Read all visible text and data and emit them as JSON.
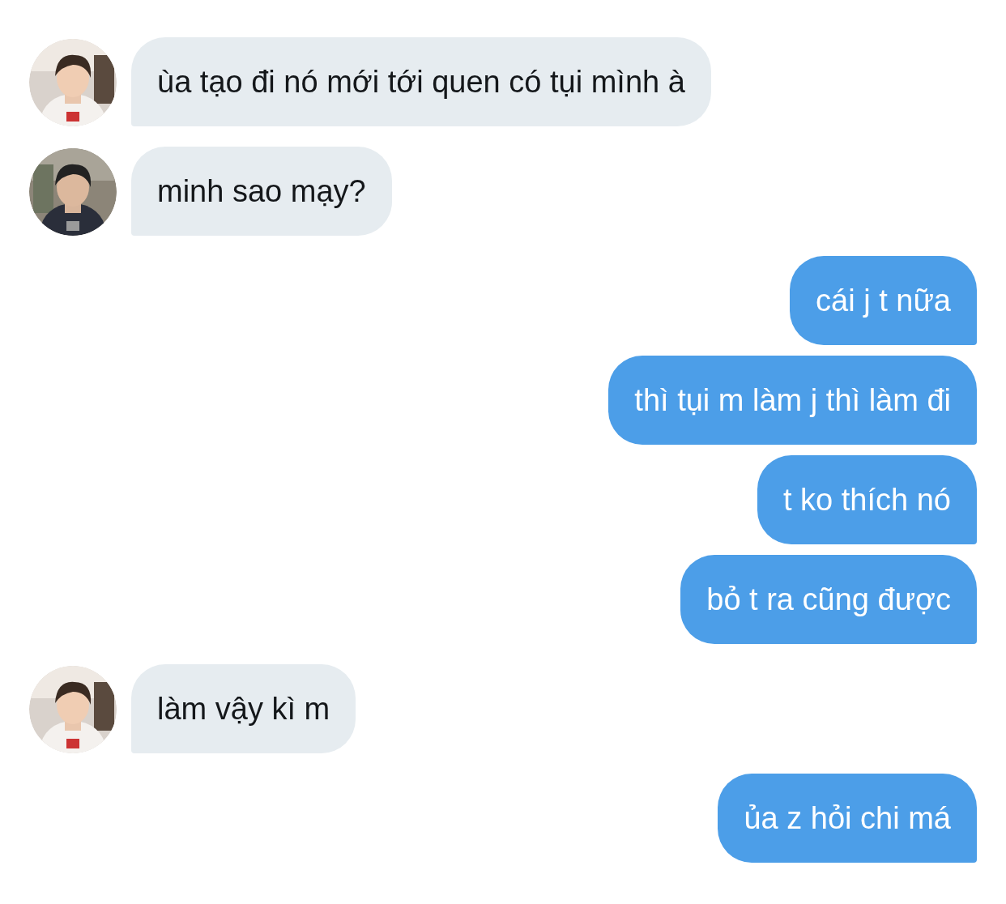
{
  "messages": [
    {
      "kind": "received",
      "text": "ùa tạo đi nó mới tới quen có tụi mình à"
    },
    {
      "kind": "received",
      "text": "minh sao mạy?"
    },
    {
      "kind": "sent",
      "text": "cái j t nữa"
    },
    {
      "kind": "sent",
      "text": "thì tụi m làm j thì làm đi"
    },
    {
      "kind": "sent",
      "text": "t ko thích nó"
    },
    {
      "kind": "sent",
      "text": "bỏ t ra cũng được"
    },
    {
      "kind": "received",
      "text": "làm vậy kì m"
    },
    {
      "kind": "sent",
      "text": "ủa z hỏi chi má"
    }
  ]
}
